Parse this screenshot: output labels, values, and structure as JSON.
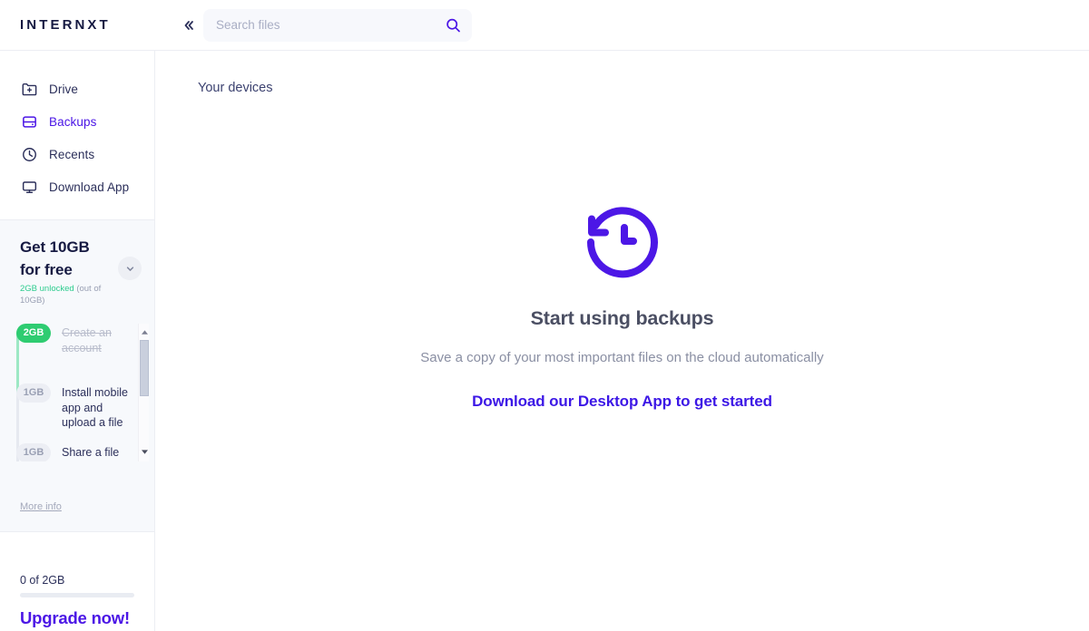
{
  "app": {
    "logo": "INTERNXT",
    "accent_color": "#4c17e6",
    "green_color": "#2ecc71",
    "text_color": "#2b2f5a"
  },
  "header": {
    "collapse_icon": "chevrons-left-icon",
    "search": {
      "placeholder": "Search files",
      "value": "",
      "icon": "search-icon"
    }
  },
  "sidebar": {
    "nav": [
      {
        "label": "Drive",
        "icon": "folder-plus-icon",
        "active": false
      },
      {
        "label": "Backups",
        "icon": "hard-drive-icon",
        "active": true
      },
      {
        "label": "Recents",
        "icon": "clock-icon",
        "active": false
      },
      {
        "label": "Download App",
        "icon": "monitor-icon",
        "active": false
      }
    ],
    "promo": {
      "title_line1": "Get 10GB",
      "title_line2": "for free",
      "unlocked": "2GB unlocked",
      "out_of": "(out of 10GB)",
      "toggle_icon": "chevron-down-icon",
      "steps": [
        {
          "badge": "2GB",
          "text": "Create an account",
          "done": true
        },
        {
          "badge": "1GB",
          "text": "Install mobile app and upload a file",
          "done": false
        },
        {
          "badge": "1GB",
          "text": "Share a file via link",
          "done": false
        }
      ],
      "more_info": "More info",
      "scrollbar": {
        "up_icon": "scroll-up-arrow-icon",
        "down_icon": "scroll-down-arrow-icon"
      }
    },
    "storage": {
      "usage": "0 of 2GB",
      "progress_percent": 0,
      "upgrade_label": "Upgrade now!"
    }
  },
  "main": {
    "title": "Your devices",
    "empty_state": {
      "icon": "clock-counterclockwise-icon",
      "heading": "Start using backups",
      "description": "Save a copy of your most important files on the cloud automatically",
      "link": "Download our Desktop App to get started"
    }
  }
}
